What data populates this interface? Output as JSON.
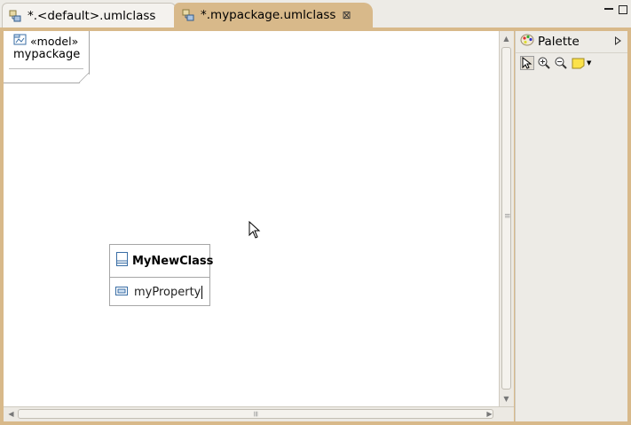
{
  "tabs": [
    {
      "label": "*.<default>.umlclass",
      "active": false,
      "icon": "uml-diagram-icon"
    },
    {
      "label": "*.mypackage.umlclass",
      "active": true,
      "icon": "uml-diagram-icon",
      "close": "⊠"
    }
  ],
  "window_controls": {
    "minimize_icon": "minimize-icon",
    "maximize_icon": "maximize-icon"
  },
  "model": {
    "stereotype": "«model»",
    "name": "mypackage"
  },
  "class": {
    "name": "MyNewClass",
    "property": "myProperty"
  },
  "palette": {
    "title": "Palette",
    "tools": [
      "select-tool-icon",
      "zoom-in-icon",
      "zoom-out-icon",
      "note-icon",
      "dropdown-arrow-icon"
    ]
  },
  "colors": {
    "accent": "#d8b98a",
    "canvas": "#ffffff",
    "chrome": "#edebe6"
  }
}
